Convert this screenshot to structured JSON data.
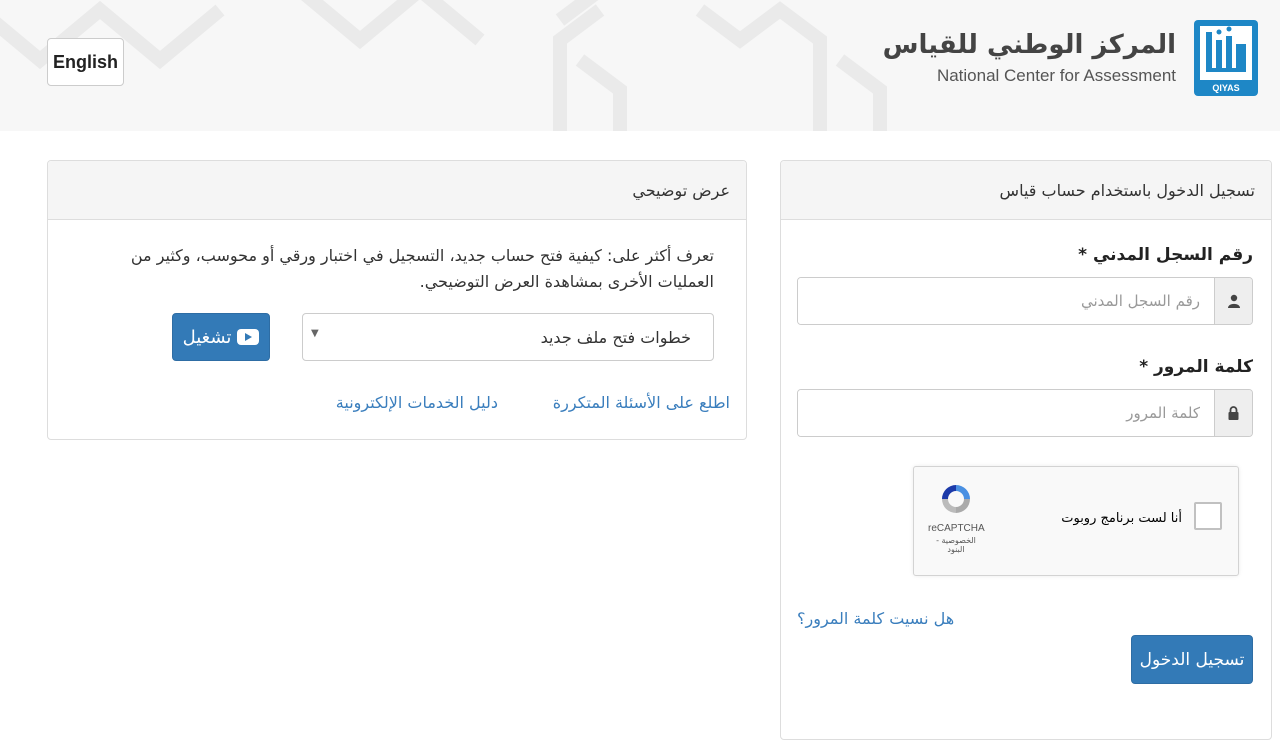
{
  "header": {
    "language_button": "English",
    "brand_arabic": "المركز الوطني للقياس",
    "brand_english": "National Center for Assessment",
    "logo_caption": "QIYAS"
  },
  "login": {
    "panel_title": "تسجيل الدخول باستخدام حساب قياس",
    "civil_id_label": "رقم السجل المدني *",
    "civil_id_placeholder": "رقم السجل المدني",
    "password_label": "كلمة المرور *",
    "password_placeholder": "كلمة المرور",
    "captcha_label": "أنا لست برنامج روبوت",
    "captcha_brand": "reCAPTCHA",
    "captcha_links": "الخصوصية - البنود",
    "forgot_password": "هل نسيت كلمة المرور؟",
    "submit": "تسجيل الدخول"
  },
  "demo": {
    "panel_title": "عرض توضيحي",
    "description": "تعرف أكثر على: كيفية فتح حساب جديد، التسجيل في اختبار ورقي أو محوسب، وكثير من العمليات الأخرى بمشاهدة العرض التوضيحي.",
    "selected_option": "خطوات فتح ملف جديد",
    "play_button": "تشغيل",
    "faq_link": "اطلع على الأسئلة المتكررة",
    "guide_link": "دليل الخدمات الإلكترونية"
  },
  "colors": {
    "primary": "#337ab7",
    "link": "#3a7ebd",
    "logo": "#1e87c6"
  },
  "icons": {
    "civil_id": "user-icon",
    "password": "lock-icon",
    "play": "youtube-play-icon",
    "captcha": "recaptcha-icon"
  }
}
